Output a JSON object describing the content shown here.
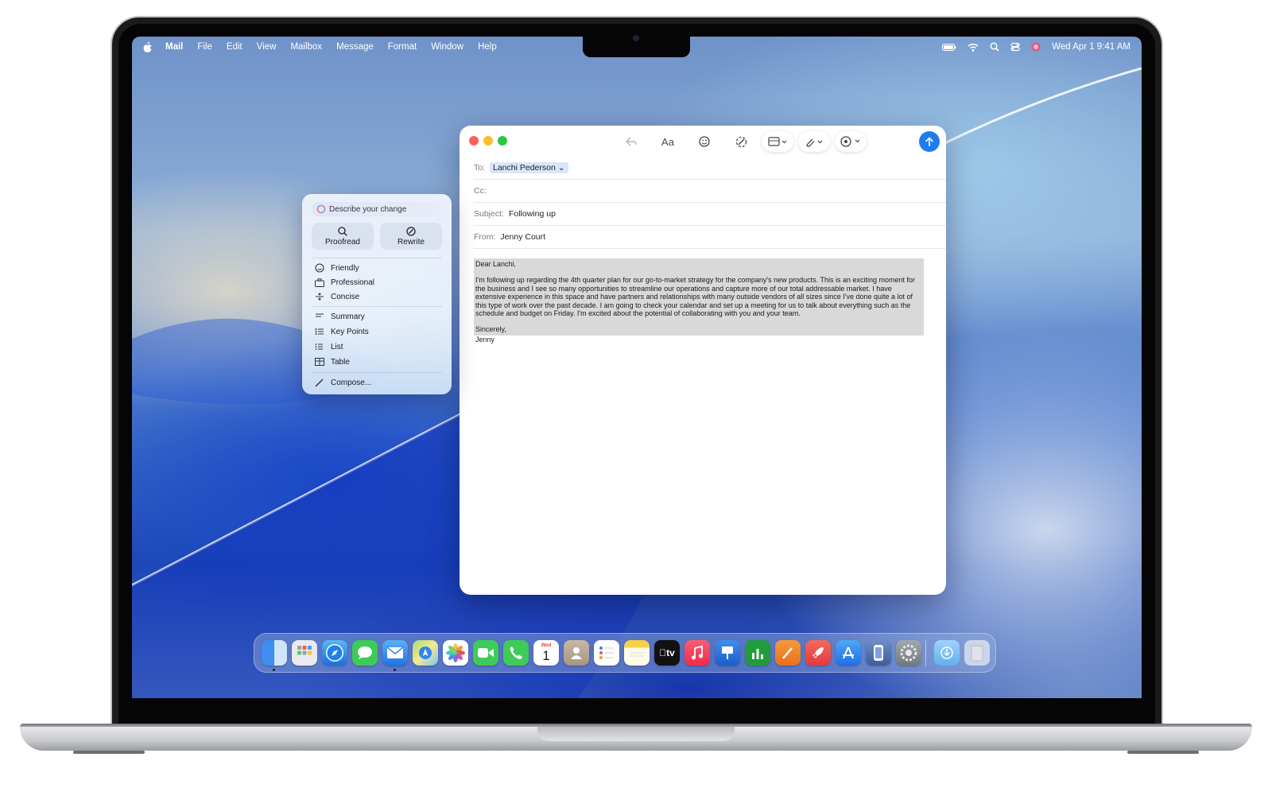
{
  "menubar": {
    "app_name": "Mail",
    "items": [
      "File",
      "Edit",
      "View",
      "Mailbox",
      "Message",
      "Format",
      "Window",
      "Help"
    ],
    "datetime": "Wed Apr 1  9:41 AM",
    "status_icons": [
      "battery-icon",
      "wifi-icon",
      "search-icon",
      "control-center-icon",
      "siri-icon"
    ]
  },
  "compose": {
    "to_label": "To:",
    "to_value": "Lanchi Pederson",
    "cc_label": "Cc:",
    "subject_label": "Subject:",
    "subject_value": "Following up",
    "from_label": "From:",
    "from_value": "Jenny Court",
    "toolbar_icons": [
      "reply-icon",
      "font-icon",
      "emoji-icon",
      "writing-tools-icon",
      "format-table-icon",
      "attachment-icon",
      "markup-icon"
    ],
    "toolbar_font_label": "Aa",
    "send_icon": "send-arrow-icon",
    "body": {
      "greeting": "Dear Lanchi,",
      "paragraph": "I'm following up regarding the 4th quarter plan for our go-to-market strategy for the company's new products. This is an exciting moment for the business and I see so many opportunities to streamline our operations and capture more of our total addressable market. I have extensive experience in this space and have partners and relationships with many outside vendors of all sizes since I've done quite a lot of this type of work over the past decade. I am going to check your calendar and set up a meeting for us to talk about everything such as the schedule and budget on Friday. I'm excited about the potential of collaborating with you and your team.",
      "closing": "Sincerely,",
      "signature": "Jenny"
    }
  },
  "writing_tools": {
    "prompt_placeholder": "Describe your change",
    "proofread": "Proofread",
    "rewrite": "Rewrite",
    "tones": [
      "Friendly",
      "Professional",
      "Concise"
    ],
    "formats": [
      "Summary",
      "Key Points",
      "List",
      "Table"
    ],
    "compose": "Compose..."
  },
  "dock": {
    "apps": [
      "Finder",
      "Launchpad",
      "Safari",
      "Messages",
      "Mail",
      "Maps",
      "Photos",
      "FaceTime",
      "Phone",
      "Calendar",
      "Contacts",
      "Reminders",
      "Notes",
      "TV",
      "Music",
      "Keynote",
      "Numbers",
      "Pages",
      "Rocket",
      "App Store",
      "iPhone Mirroring",
      "System Settings"
    ],
    "calendar_month": "Wed",
    "calendar_day": "1",
    "tv_label": "tv"
  }
}
